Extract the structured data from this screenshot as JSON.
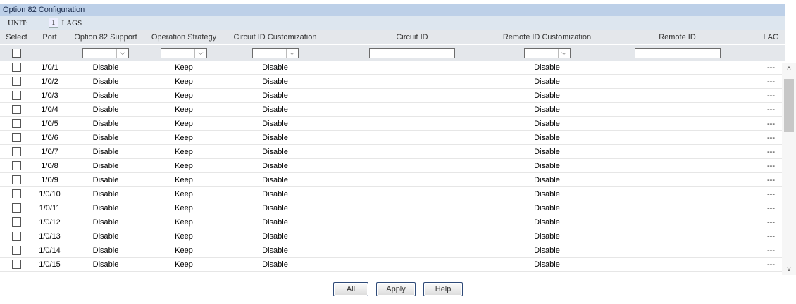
{
  "panel": {
    "title": "Option 82 Configuration"
  },
  "unit": {
    "label": "UNIT:",
    "number": "1",
    "lags": "LAGS"
  },
  "columns": [
    "Select",
    "Port",
    "Option 82 Support",
    "Operation Strategy",
    "Circuit ID Customization",
    "Circuit ID",
    "Remote ID Customization",
    "Remote ID",
    "LAG"
  ],
  "filter": {
    "support": "",
    "strategy": "",
    "circuit_custom": "",
    "circuit_id": "",
    "remote_custom": "",
    "remote_id": ""
  },
  "rows": [
    {
      "port": "1/0/1",
      "support": "Disable",
      "strategy": "Keep",
      "circuit_custom": "Disable",
      "circuit_id": "",
      "remote_custom": "Disable",
      "remote_id": "",
      "lag": "---"
    },
    {
      "port": "1/0/2",
      "support": "Disable",
      "strategy": "Keep",
      "circuit_custom": "Disable",
      "circuit_id": "",
      "remote_custom": "Disable",
      "remote_id": "",
      "lag": "---"
    },
    {
      "port": "1/0/3",
      "support": "Disable",
      "strategy": "Keep",
      "circuit_custom": "Disable",
      "circuit_id": "",
      "remote_custom": "Disable",
      "remote_id": "",
      "lag": "---"
    },
    {
      "port": "1/0/4",
      "support": "Disable",
      "strategy": "Keep",
      "circuit_custom": "Disable",
      "circuit_id": "",
      "remote_custom": "Disable",
      "remote_id": "",
      "lag": "---"
    },
    {
      "port": "1/0/5",
      "support": "Disable",
      "strategy": "Keep",
      "circuit_custom": "Disable",
      "circuit_id": "",
      "remote_custom": "Disable",
      "remote_id": "",
      "lag": "---"
    },
    {
      "port": "1/0/6",
      "support": "Disable",
      "strategy": "Keep",
      "circuit_custom": "Disable",
      "circuit_id": "",
      "remote_custom": "Disable",
      "remote_id": "",
      "lag": "---"
    },
    {
      "port": "1/0/7",
      "support": "Disable",
      "strategy": "Keep",
      "circuit_custom": "Disable",
      "circuit_id": "",
      "remote_custom": "Disable",
      "remote_id": "",
      "lag": "---"
    },
    {
      "port": "1/0/8",
      "support": "Disable",
      "strategy": "Keep",
      "circuit_custom": "Disable",
      "circuit_id": "",
      "remote_custom": "Disable",
      "remote_id": "",
      "lag": "---"
    },
    {
      "port": "1/0/9",
      "support": "Disable",
      "strategy": "Keep",
      "circuit_custom": "Disable",
      "circuit_id": "",
      "remote_custom": "Disable",
      "remote_id": "",
      "lag": "---"
    },
    {
      "port": "1/0/10",
      "support": "Disable",
      "strategy": "Keep",
      "circuit_custom": "Disable",
      "circuit_id": "",
      "remote_custom": "Disable",
      "remote_id": "",
      "lag": "---"
    },
    {
      "port": "1/0/11",
      "support": "Disable",
      "strategy": "Keep",
      "circuit_custom": "Disable",
      "circuit_id": "",
      "remote_custom": "Disable",
      "remote_id": "",
      "lag": "---"
    },
    {
      "port": "1/0/12",
      "support": "Disable",
      "strategy": "Keep",
      "circuit_custom": "Disable",
      "circuit_id": "",
      "remote_custom": "Disable",
      "remote_id": "",
      "lag": "---"
    },
    {
      "port": "1/0/13",
      "support": "Disable",
      "strategy": "Keep",
      "circuit_custom": "Disable",
      "circuit_id": "",
      "remote_custom": "Disable",
      "remote_id": "",
      "lag": "---"
    },
    {
      "port": "1/0/14",
      "support": "Disable",
      "strategy": "Keep",
      "circuit_custom": "Disable",
      "circuit_id": "",
      "remote_custom": "Disable",
      "remote_id": "",
      "lag": "---"
    },
    {
      "port": "1/0/15",
      "support": "Disable",
      "strategy": "Keep",
      "circuit_custom": "Disable",
      "circuit_id": "",
      "remote_custom": "Disable",
      "remote_id": "",
      "lag": "---"
    }
  ],
  "scrollbar": {
    "up_glyph": "^",
    "down_glyph": "v"
  },
  "buttons": {
    "all": "All",
    "apply": "Apply",
    "help": "Help"
  }
}
